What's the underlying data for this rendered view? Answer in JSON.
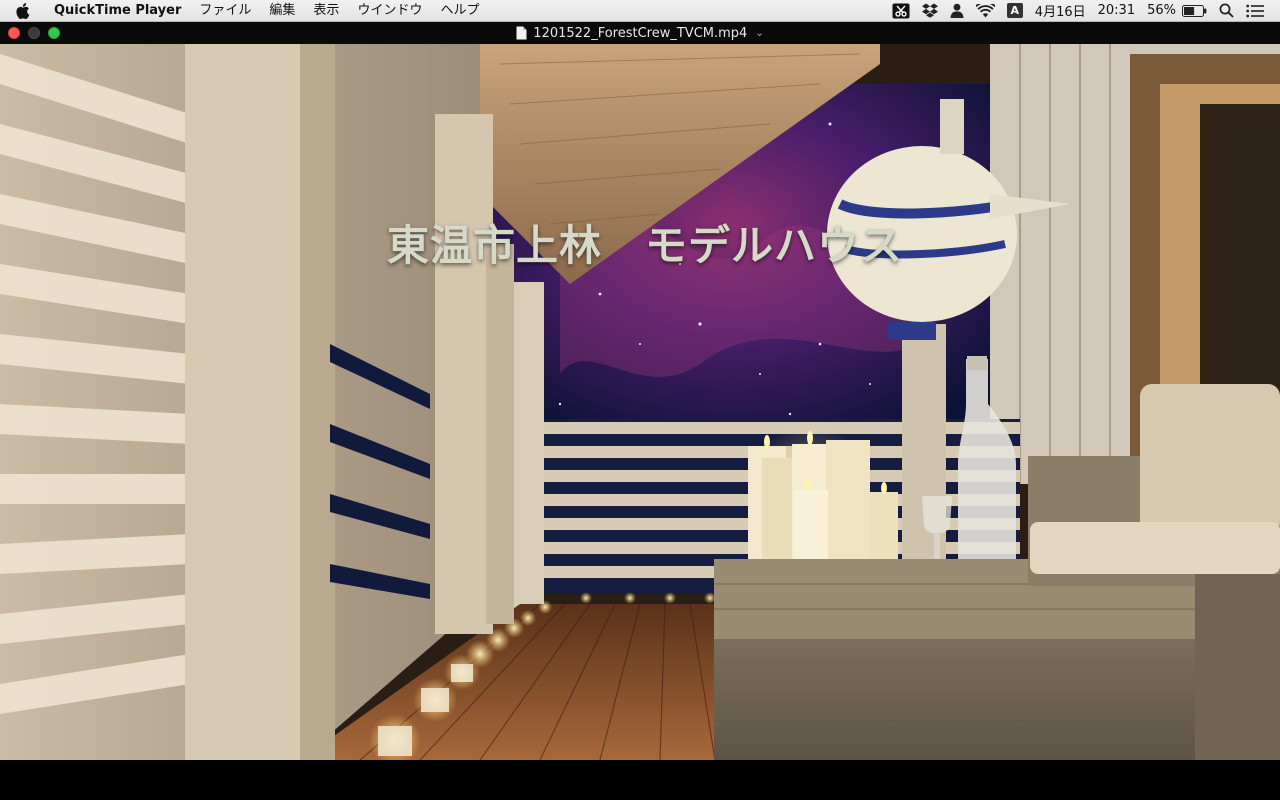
{
  "menubar": {
    "apple_icon": "apple-logo-icon",
    "app_name": "QuickTime Player",
    "menus": [
      "ファイル",
      "編集",
      "表示",
      "ウインドウ",
      "ヘルプ"
    ],
    "status": {
      "ime_letter": "A",
      "date": "4月16日",
      "time": "20:31",
      "battery_percent": "56%",
      "battery_level": 0.56
    }
  },
  "window": {
    "title": "1201522_ForestCrew_TVCM.mp4",
    "title_chevron": "⌄"
  },
  "video": {
    "caption": "東温市上林　モデルハウス"
  },
  "colors": {
    "close": "#fc5b57",
    "zoom": "#34c84a",
    "caption": "#d6d8c8"
  }
}
